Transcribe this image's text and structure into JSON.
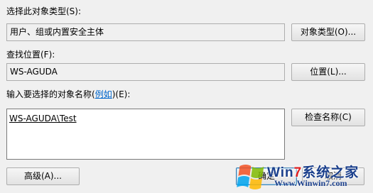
{
  "object_type": {
    "label": "选择此对象类型(S):",
    "value": "用户、组或内置安全主体",
    "button_label": "对象类型(O)..."
  },
  "location": {
    "label": "查找位置(F):",
    "value": "WS-AGUDA",
    "button_label": "位置(L)..."
  },
  "names": {
    "label_prefix": "输入要选择的对象名称(",
    "label_link": "例如",
    "label_suffix": ")(E):",
    "value": "WS-AGUDA\\Test",
    "check_button_label": "检查名称(C)"
  },
  "footer": {
    "advanced_label": "高级(A)...",
    "ok_label": "确定",
    "cancel_label": "取消"
  },
  "watermark": {
    "brand_prefix": "Win",
    "brand_seven": "7",
    "brand_suffix": "系统之家",
    "url": "Www.Winwin7.com",
    "logo_icon": "windows-flag-icon"
  }
}
